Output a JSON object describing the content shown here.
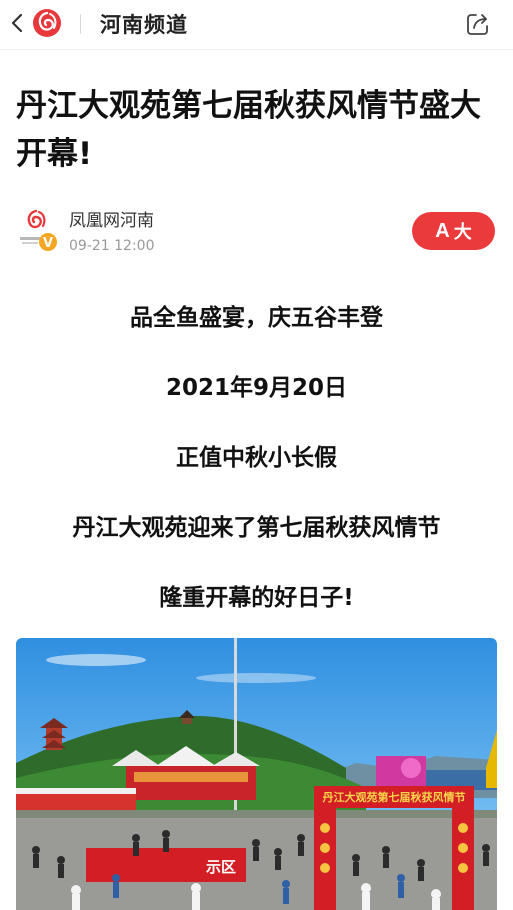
{
  "header": {
    "channel_title": "河南频道",
    "back_icon": "chevron-left-icon",
    "logo_icon": "phoenix-logo-icon",
    "share_icon": "share-icon"
  },
  "article": {
    "title": "丹江大观苑第七届秋获风情节盛大开幕!",
    "author": {
      "name": "凤凰网河南",
      "date": "09-21 12:00",
      "verified_badge": "V"
    },
    "font_size_button": {
      "icon_glyph": "A",
      "label": "大"
    },
    "paragraphs": [
      "品全鱼盛宴，庆五谷丰登",
      "2021年9月20日",
      "正值中秋小长假",
      "丹江大观苑迎来了第七届秋获风情节",
      "隆重开幕的好日子!"
    ],
    "photo": {
      "gate_banner": "丹江大观苑第七届秋获风情节",
      "sign_text": "示区"
    }
  },
  "colors": {
    "accent": "#ea3a3c",
    "verified": "#f5a623"
  }
}
